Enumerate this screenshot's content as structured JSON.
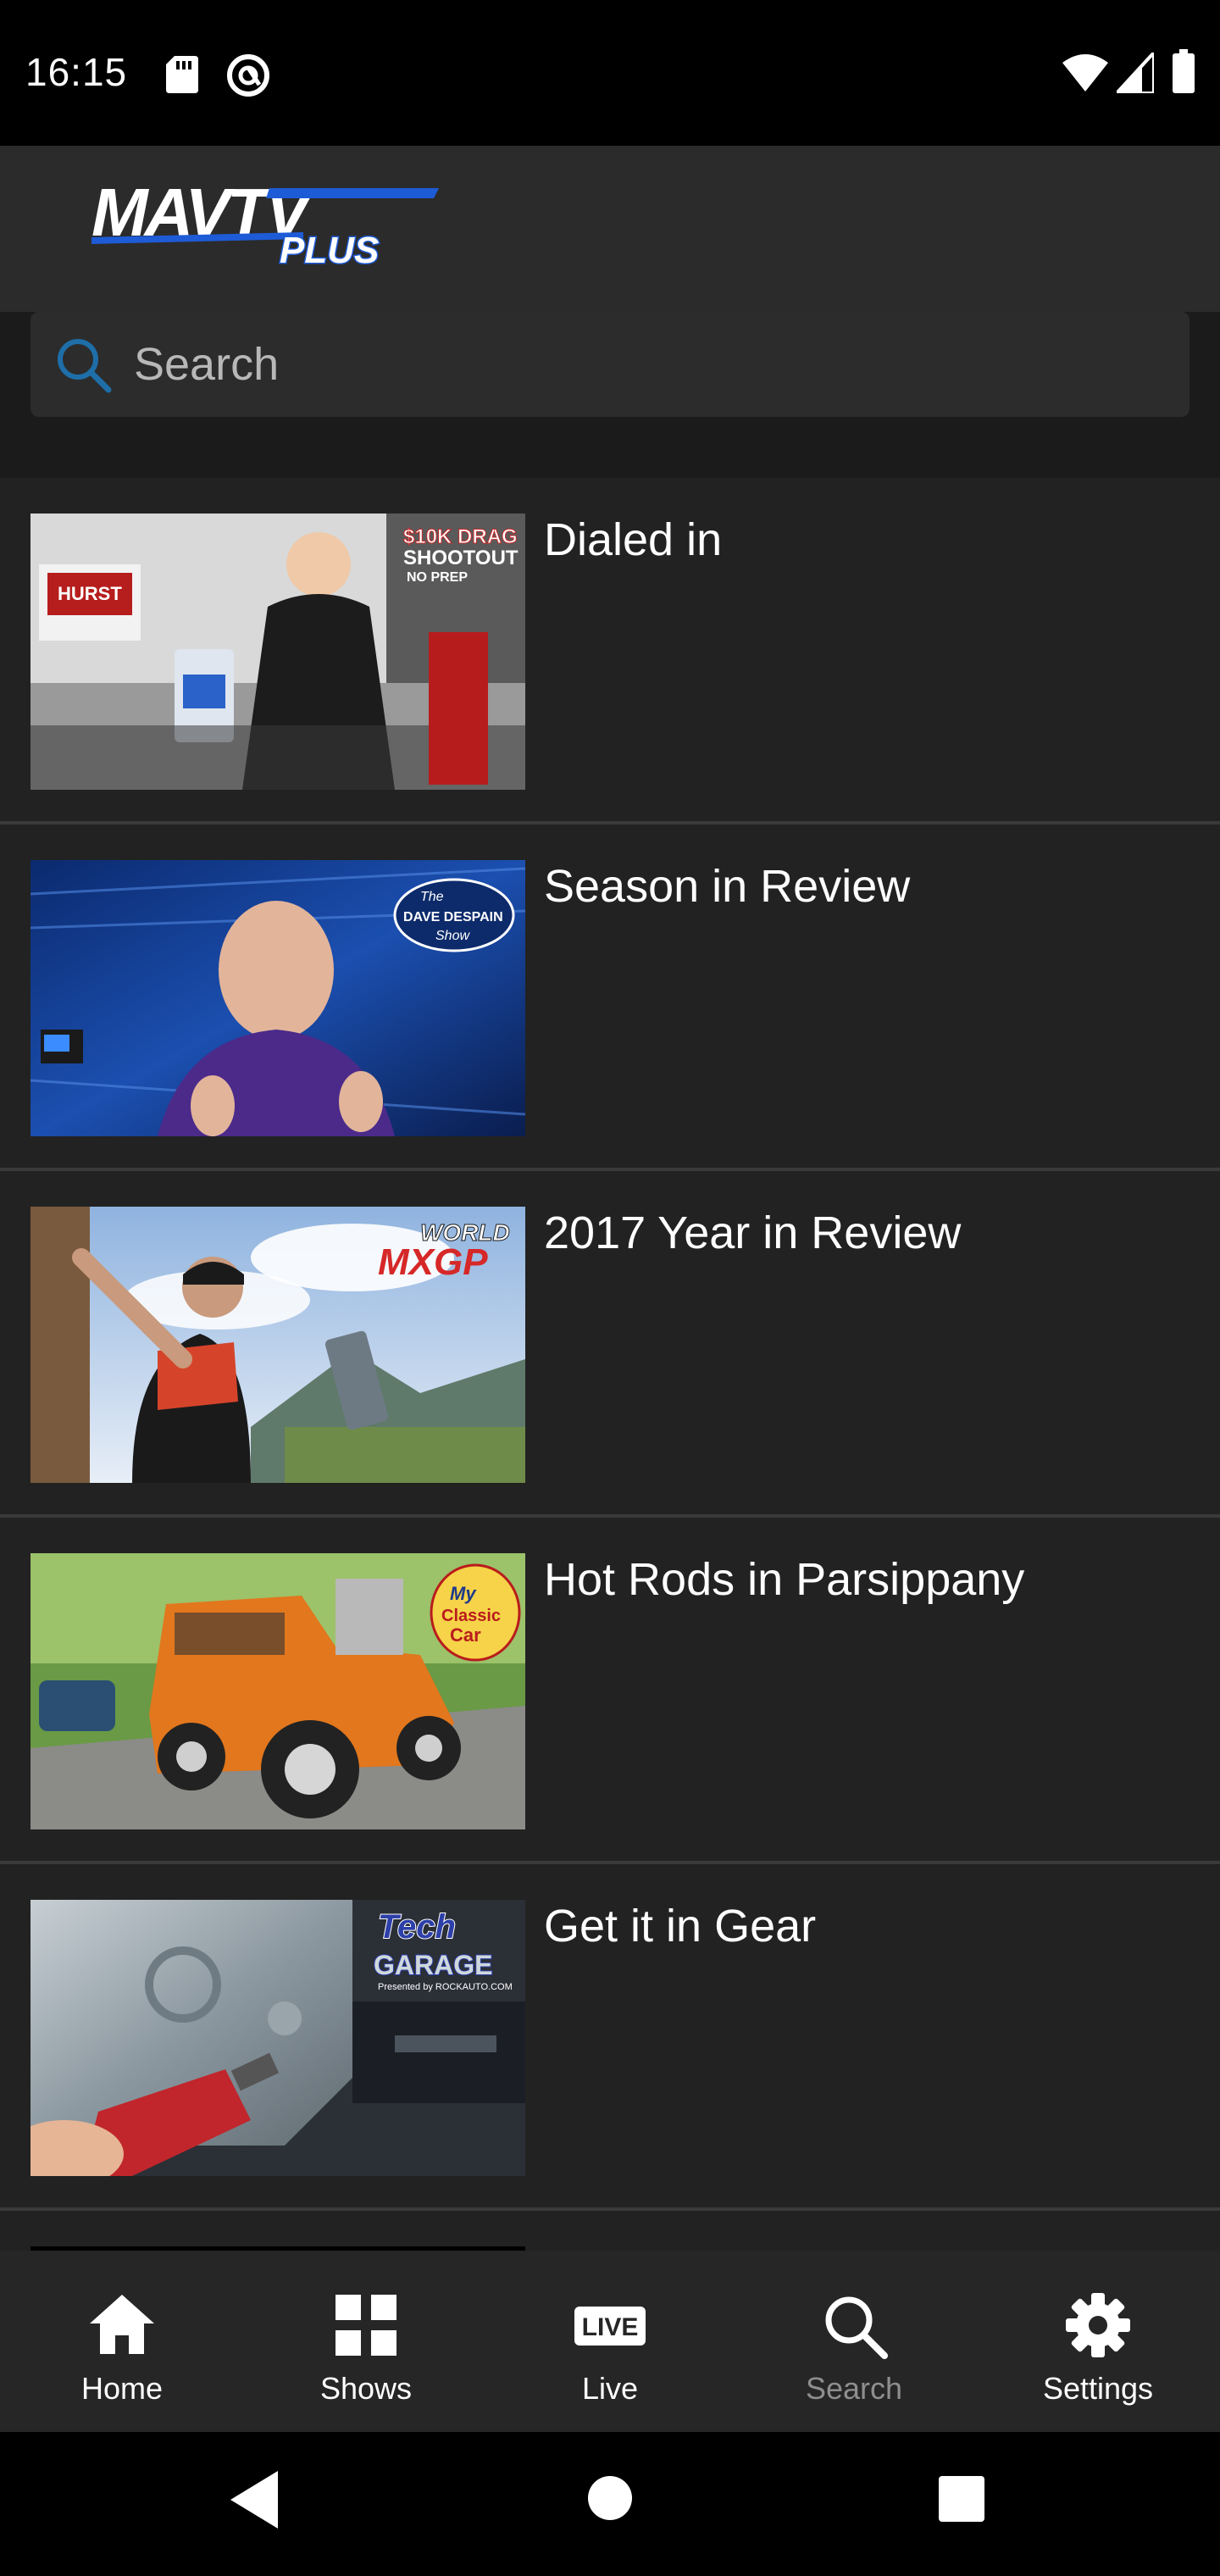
{
  "status_bar": {
    "time": "16:15",
    "icons": [
      "sd-card-icon",
      "data-saver-icon",
      "wifi-icon",
      "signal-icon",
      "battery-icon"
    ]
  },
  "header": {
    "logo_text": "MAVTV",
    "logo_subtext": "PLUS",
    "brand_colors": {
      "blue": "#1e5bd6",
      "white": "#ffffff"
    }
  },
  "search": {
    "placeholder": "Search",
    "value": ""
  },
  "list": {
    "items": [
      {
        "title": "Dialed in",
        "thumbnail": "drag-shootout-mechanic-thumbnail",
        "badge": "$10K DRAG SHOOTOUT NO PREP"
      },
      {
        "title": "Season in Review",
        "thumbnail": "dave-despain-show-thumbnail",
        "badge": "The DAVE DESPAIN Show"
      },
      {
        "title": "2017 Year in Review",
        "thumbnail": "world-mxgp-thumbnail",
        "badge": "FIM WORLD MXGP"
      },
      {
        "title": "Hot Rods in Parsippany",
        "thumbnail": "my-classic-car-thumbnail",
        "badge": "My Classic Car"
      },
      {
        "title": "Get it in Gear",
        "thumbnail": "tech-garage-thumbnail",
        "badge": "Tech GARAGE Presented by ROCKAUTO.COM"
      }
    ]
  },
  "bottom_nav": {
    "items": [
      {
        "label": "Home",
        "icon": "home-icon",
        "active": true
      },
      {
        "label": "Shows",
        "icon": "grid-icon",
        "active": false
      },
      {
        "label": "Live",
        "icon": "live-icon",
        "active": false
      },
      {
        "label": "Search",
        "icon": "search-icon",
        "active": false,
        "dimmed": true
      },
      {
        "label": "Settings",
        "icon": "gear-icon",
        "active": false
      }
    ]
  },
  "system_nav": {
    "icons": [
      "back-icon",
      "home-circle-icon",
      "recents-icon"
    ]
  },
  "colors": {
    "background": "#222222",
    "header": "#2b2b2b",
    "search_box": "#2c2c2c",
    "search_icon": "#1e6ea8",
    "divider": "#3a3a3a",
    "nav_background": "#262626",
    "dim_label": "#8e8e8e"
  }
}
